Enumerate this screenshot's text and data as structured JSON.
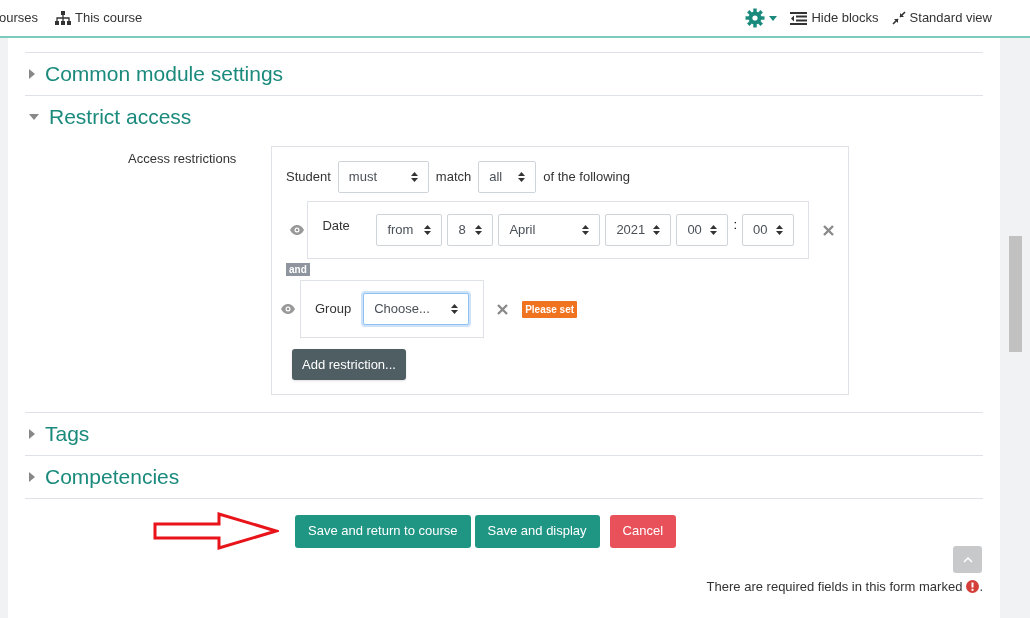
{
  "navbar": {
    "left_items": [
      {
        "label": "ourses",
        "kind": "plain"
      },
      {
        "label": "This course",
        "kind": "course"
      }
    ],
    "right_items": [
      {
        "kind": "gear"
      },
      {
        "kind": "hide",
        "label": "Hide blocks"
      },
      {
        "kind": "view",
        "label": "Standard view"
      }
    ]
  },
  "sections": [
    {
      "title": "Common module settings",
      "expanded": false
    },
    {
      "title": "Restrict access",
      "expanded": true,
      "content": {
        "label": "Access restrictions",
        "header": {
          "prefix": "Student",
          "must": "must",
          "middle": "match",
          "all": "all",
          "suffix": "of the following"
        },
        "conditions": [
          {
            "kind": "date",
            "visible": true,
            "label": "Date",
            "fields": [
              {
                "value": "from",
                "focused": false
              },
              {
                "value": "8",
                "focused": false
              },
              {
                "value": "April",
                "focused": false
              },
              {
                "value": "2021",
                "focused": false
              },
              {
                "value": "00",
                "focused": false
              },
              {
                "value": "00",
                "focused": false
              }
            ],
            "separator": ":"
          },
          {
            "kind": "group",
            "visible": true,
            "label": "Group",
            "fields": [
              {
                "value": "Choose...",
                "focused": true
              }
            ],
            "badge": "Please set"
          }
        ],
        "connector": "and",
        "add_button": "Add restriction..."
      }
    },
    {
      "title": "Tags",
      "expanded": false
    },
    {
      "title": "Competencies",
      "expanded": false
    }
  ],
  "buttons": [
    {
      "label": "Save and return to course",
      "kind": "primary"
    },
    {
      "label": "Save and display",
      "kind": "primary"
    },
    {
      "label": "Cancel",
      "kind": "danger"
    }
  ],
  "required_note": "There are required fields in this form marked",
  "required_note_end": "."
}
